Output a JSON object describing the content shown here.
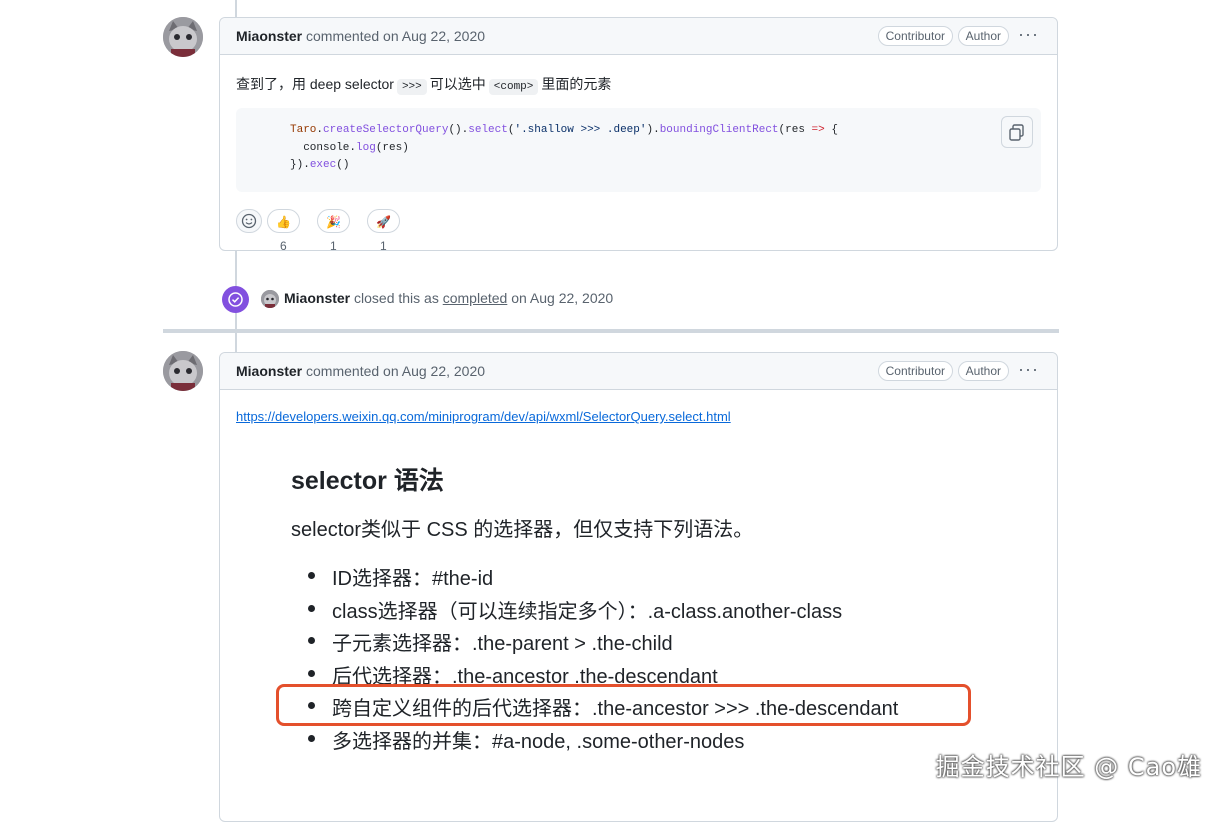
{
  "comment1": {
    "author": "Miaonster",
    "action": "commented on Aug 22, 2020",
    "badge_contributor": "Contributor",
    "badge_author": "Author",
    "menu_icon": "kebab-horizontal-icon",
    "text_before": "查到了，用 deep selector",
    "code1": ">>>",
    "text_middle": "可以选中",
    "code2": "<comp>",
    "text_after": "里面的元素",
    "codeblock": {
      "line1_obj": "Taro",
      "line1_dot": ".",
      "line1_fn1": "createSelectorQuery",
      "line1_p1": "().",
      "line1_fn2": "select",
      "line1_p2": "(",
      "line1_str": "'.shallow >>> .deep'",
      "line1_p3": ").",
      "line1_fn3": "boundingClientRect",
      "line1_p4": "(res ",
      "line1_op": "=>",
      "line1_p5": " {",
      "line2_a": "  console.",
      "line2_fn": "log",
      "line2_b": "(res)",
      "line3_a": "}).",
      "line3_fn": "exec",
      "line3_b": "()"
    },
    "copy_icon": "copy-icon",
    "reactions": [
      {
        "emoji": "👍",
        "count": "6"
      },
      {
        "emoji": "🎉",
        "count": "1"
      },
      {
        "emoji": "🚀",
        "count": "1"
      }
    ]
  },
  "event": {
    "author": "Miaonster",
    "text1": "closed this as",
    "link": "completed",
    "text2": "on Aug 22, 2020"
  },
  "comment2": {
    "author": "Miaonster",
    "action": "commented on Aug 22, 2020",
    "badge_contributor": "Contributor",
    "badge_author": "Author",
    "link_url": "https://developers.weixin.qq.com/miniprogram/dev/api/wxml/SelectorQuery.select.html",
    "doc_title": "selector 语法",
    "doc_intro": "selector类似于 CSS 的选择器，但仅支持下列语法。",
    "list": [
      "ID选择器：#the-id",
      "class选择器（可以连续指定多个）：.a-class.another-class",
      "子元素选择器：.the-parent > .the-child",
      "后代选择器：.the-ancestor .the-descendant",
      "跨自定义组件的后代选择器：.the-ancestor >>> .the-descendant",
      "多选择器的并集：#a-node, .some-other-nodes"
    ]
  },
  "watermark": "掘金技术社区 @ Cao雄",
  "colors": {
    "accent_purple": "#8250df",
    "link_blue": "#0969da",
    "highlight_red": "#e4502c"
  }
}
